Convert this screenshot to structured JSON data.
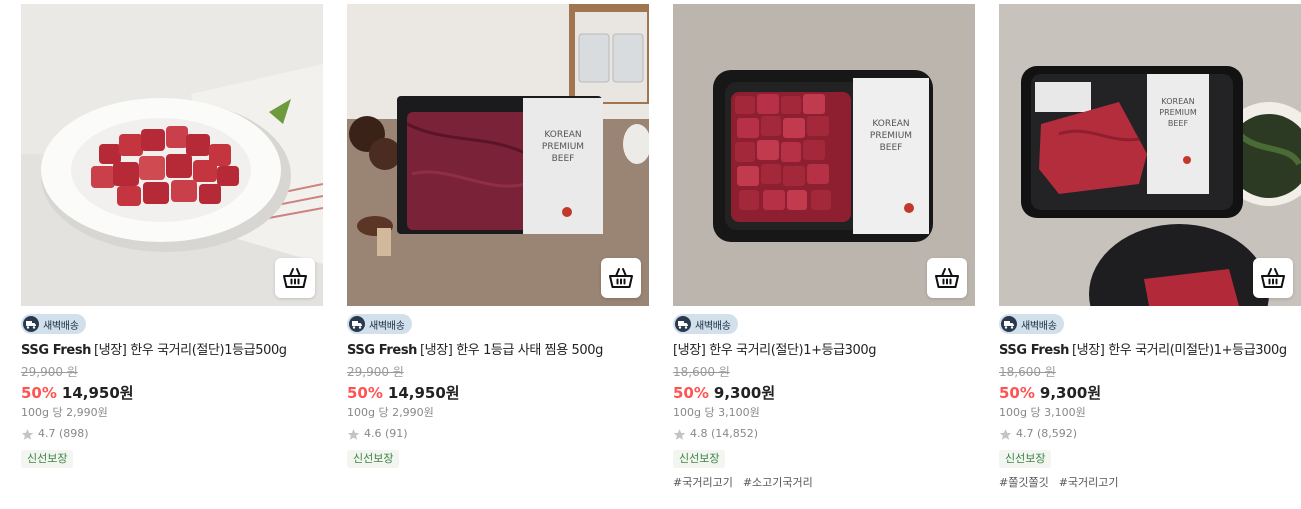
{
  "products": [
    {
      "badge": "새벽배송",
      "brand": "SSG Fresh",
      "name": "[냉장] 한우 국거리(절단)1등급500g",
      "original_price": "29,900 원",
      "discount": "50%",
      "price": "14,950원",
      "unit_price": "100g 당 2,990원",
      "rating": "4.7",
      "reviews": "(898)",
      "tag": "신선보장",
      "hashtags": []
    },
    {
      "badge": "새벽배송",
      "brand": "SSG Fresh",
      "name": "[냉장] 한우 1등급 사태 찜용 500g",
      "original_price": "29,900 원",
      "discount": "50%",
      "price": "14,950원",
      "unit_price": "100g 당 2,990원",
      "rating": "4.6",
      "reviews": "(91)",
      "tag": "신선보장",
      "hashtags": []
    },
    {
      "badge": "새벽배송",
      "brand": "",
      "name": "[냉장] 한우 국거리(절단)1+등급300g",
      "original_price": "18,600 원",
      "discount": "50%",
      "price": "9,300원",
      "unit_price": "100g 당 3,100원",
      "rating": "4.8",
      "reviews": "(14,852)",
      "tag": "신선보장",
      "hashtags": [
        "#국거리고기",
        "#소고기국거리"
      ]
    },
    {
      "badge": "새벽배송",
      "brand": "SSG Fresh",
      "name": "[냉장] 한우 국거리(미절단)1+등급300g",
      "original_price": "18,600 원",
      "discount": "50%",
      "price": "9,300원",
      "unit_price": "100g 당 3,100원",
      "rating": "4.7",
      "reviews": "(8,592)",
      "tag": "신선보장",
      "hashtags": [
        "#쫄깃쫄깃",
        "#국거리고기"
      ]
    }
  ],
  "icons": {
    "cart": "basket-icon",
    "badge": "delivery-truck-icon",
    "rating": "star-icon"
  },
  "colors": {
    "discount": "#ff5452",
    "badge_bg": "#d2e0ec",
    "tag_text": "#3f8447"
  }
}
